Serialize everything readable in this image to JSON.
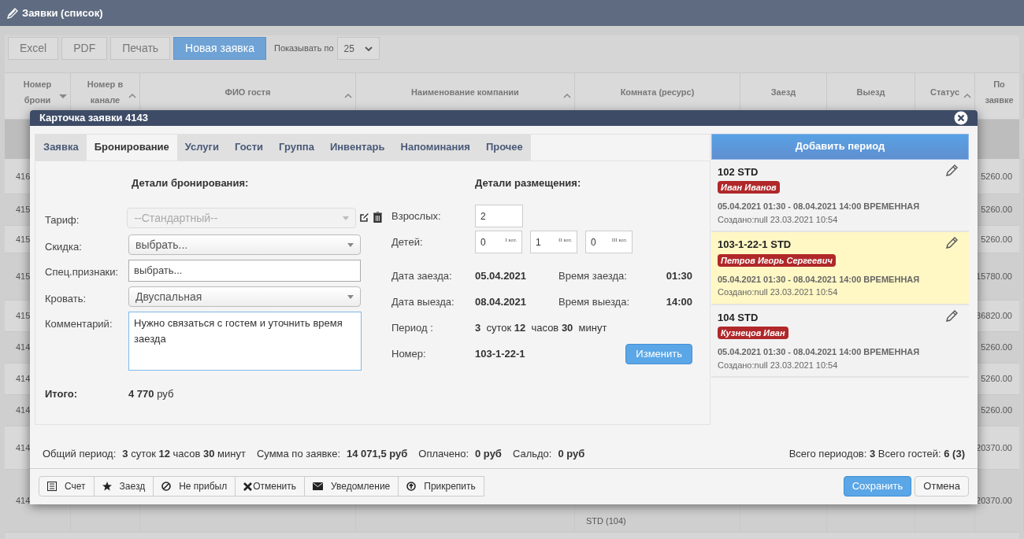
{
  "page": {
    "title": "Заявки (список)"
  },
  "toolbar": {
    "buttons": [
      {
        "label": "Excel",
        "kind": "default"
      },
      {
        "label": "PDF",
        "kind": "default"
      },
      {
        "label": "Печать",
        "kind": "default"
      },
      {
        "label": "Новая заявка",
        "kind": "primary"
      }
    ],
    "page_size_label": "Показывать по",
    "page_size": "25"
  },
  "table": {
    "columns": [
      {
        "label": "Номер брони",
        "sort_descending": true
      },
      {
        "label": "Номер в канале",
        "sort_descending": false
      },
      {
        "label": "ФИО гостя",
        "sort_descending": false
      },
      {
        "label": "Наименование компании",
        "sort_descending": false
      },
      {
        "label": "Комната (ресурс)"
      },
      {
        "label": "Заезд"
      },
      {
        "label": "Выезд"
      },
      {
        "label": "Статус",
        "sort_descending": false
      },
      {
        "label": "По заявке"
      }
    ],
    "rows": [
      {
        "number": "416",
        "room": "",
        "total": "5260.00"
      },
      {
        "number": "415",
        "room": "",
        "total": "5260.00"
      },
      {
        "number": "415",
        "room": "",
        "total": "5260.00"
      },
      {
        "number": "415",
        "room": "",
        "total": "15780.00"
      },
      {
        "number": "415",
        "room": "",
        "total": "36820.00"
      },
      {
        "number": "414",
        "room": "",
        "total": "5260.00"
      },
      {
        "number": "414",
        "room": "",
        "total": "5260.00"
      },
      {
        "number": "414",
        "room": "",
        "total": "5260.00"
      },
      {
        "number": "414",
        "room": "",
        "total": "20370.00"
      },
      {
        "number": "414",
        "room": "STD (104)",
        "total": "20370.00"
      }
    ]
  },
  "dialog": {
    "title": "Карточка заявки 4143",
    "tabs": [
      {
        "label": "Заявка",
        "selected": false
      },
      {
        "label": "Бронирование",
        "selected": true
      },
      {
        "label": "Услуги",
        "selected": false
      },
      {
        "label": "Гости",
        "selected": false
      },
      {
        "label": "Группа",
        "selected": false
      },
      {
        "label": "Инвентарь",
        "selected": false
      },
      {
        "label": "Напоминания",
        "selected": false
      },
      {
        "label": "Прочее",
        "selected": false
      }
    ],
    "booking_details": {
      "heading": "Детали бронирования:",
      "fields": [
        {
          "label": "Тариф:",
          "kind": "select",
          "value": "--Стандартный--",
          "disabled": true,
          "tools": true
        },
        {
          "label": "Скидка:",
          "kind": "select",
          "value": "выбрать..."
        },
        {
          "label": "Спец.признаки:",
          "kind": "input",
          "value": "выбрать..."
        },
        {
          "label": "Кровать:",
          "kind": "select",
          "value": "Двуспальная"
        },
        {
          "label": "Комментарий:",
          "kind": "textarea",
          "value": "Нужно связаться с гостем и уточнить время заезда"
        }
      ],
      "total_label": "Итого:",
      "total_value": "**4 770** руб"
    },
    "placement": {
      "heading": "Детали размещения:",
      "adults": {
        "label": "Взрослых:",
        "value": "2"
      },
      "children": {
        "label": "Детей:",
        "fields": [
          {
            "value": "0",
            "category": "I кат."
          },
          {
            "value": "1",
            "category": "II кат."
          },
          {
            "value": "0",
            "category": "III кат."
          }
        ]
      },
      "lines": [
        {
          "label": "Дата заезда:",
          "value": "05.04.2021",
          "time_label": "Время заезда:",
          "time": "01:30"
        },
        {
          "label": "Дата выезда:",
          "value": "08.04.2021",
          "time_label": "Время выезда:",
          "time": "14:00"
        }
      ],
      "period": {
        "label": "Период :",
        "value": "**3**  суток **12**  часов **30**  минут"
      },
      "room": {
        "label": "Номер:",
        "value": "103-1-22-1"
      },
      "change_button": "Изменить"
    },
    "add_period_button": "Добавить период",
    "periods": [
      {
        "room": "102 STD",
        "guest": "Иван Иванов",
        "dates": "05.04.2021 01:30 - 08.04.2021 14:00 ВРЕМЕННАЯ",
        "created": "Создано:null 23.03.2021 10:54",
        "selected": false
      },
      {
        "room": "103-1-22-1 STD",
        "guest": "Петров Игорь Сергеевич",
        "dates": "05.04.2021 01:30 - 08.04.2021 14:00 ВРЕМЕННАЯ",
        "created": "Создано:null 23.03.2021 10:54",
        "selected": true
      },
      {
        "room": "104 STD",
        "guest": "Кузнецов Иван",
        "dates": "05.04.2021 01:30 - 08.04.2021 14:00 ВРЕМЕННАЯ",
        "created": "Создано:null 23.03.2021 10:54",
        "selected": false
      }
    ],
    "summary": [
      {
        "label": "Общий период:",
        "value": "**3** суток **12** часов **30** минут"
      },
      {
        "label": "Сумма по заявке:",
        "value": "**14 071,5 руб**"
      },
      {
        "label": "Оплачено:",
        "value": "**0 руб**"
      },
      {
        "label": "Сальдо:",
        "value": "**0 руб**"
      }
    ],
    "totals": "Всего периодов: **3** Всего гостей: **6 (3)**",
    "actions": [
      {
        "label": "Счет",
        "kind": "invoice"
      },
      {
        "label": "Заезд",
        "kind": "checkin"
      },
      {
        "label": "Не прибыл",
        "kind": "no_show"
      },
      {
        "label": "Отменить",
        "kind": "cancel"
      },
      {
        "label": "Уведомление",
        "kind": "notify"
      },
      {
        "label": "Прикрепить",
        "kind": "attach"
      }
    ],
    "save_button": "Сохранить",
    "cancel_button": "Отмена"
  }
}
